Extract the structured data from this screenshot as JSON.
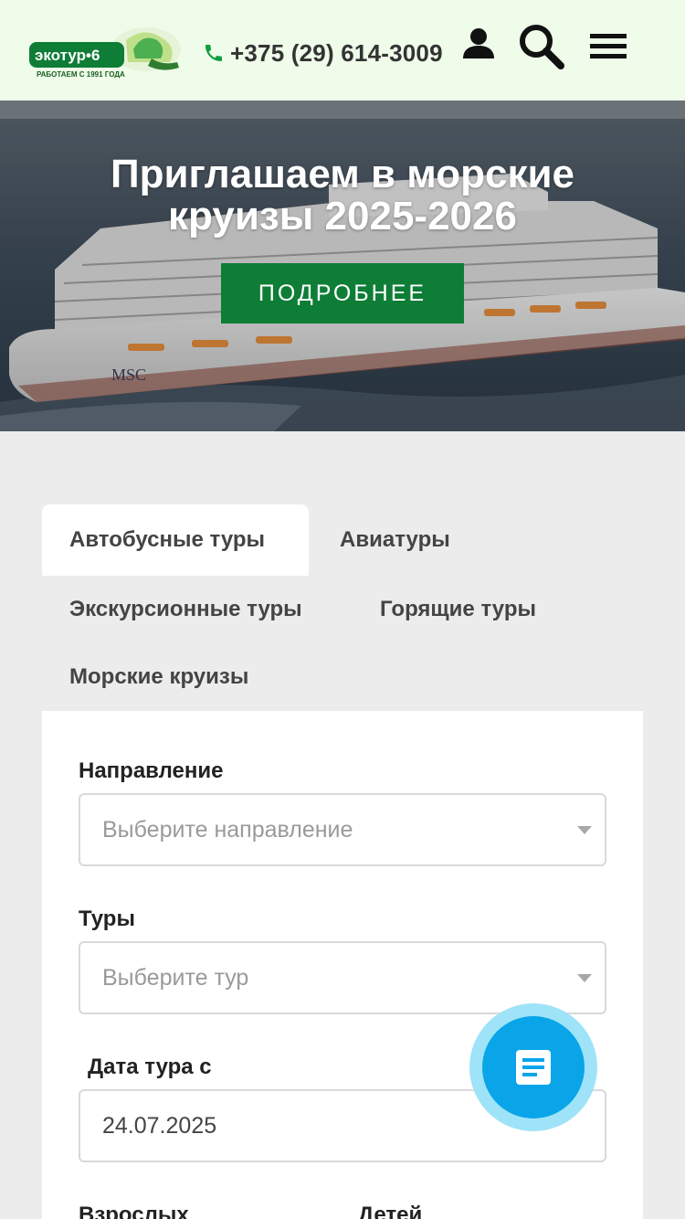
{
  "header": {
    "logo": {
      "name": "экотур•6",
      "tagline": "РАБОТАЕМ С 1991 ГОДА"
    },
    "phone": "+375 (29) 614-3009",
    "icons": [
      "phone-icon",
      "user-icon",
      "search-icon",
      "menu-icon"
    ]
  },
  "hero": {
    "title_line1": "Приглашаем в морские",
    "title_line2": "круизы 2025-2026",
    "button_label": "ПОДРОБНЕЕ",
    "ship_label": "MSC"
  },
  "tabs": [
    {
      "label": "Автобусные туры",
      "active": true
    },
    {
      "label": "Авиатуры",
      "active": false
    },
    {
      "label": "Экскурсионные туры",
      "active": false
    },
    {
      "label": "Горящие туры",
      "active": false
    },
    {
      "label": "Морские круизы",
      "active": false
    }
  ],
  "form": {
    "direction": {
      "label": "Направление",
      "placeholder": "Выберите направление"
    },
    "tours": {
      "label": "Туры",
      "placeholder": "Выберите тур"
    },
    "date_from": {
      "label": "Дата тура с",
      "value": "24.07.2025"
    },
    "adults": {
      "label": "Взрослых"
    },
    "children": {
      "label": "Детей"
    }
  },
  "colors": {
    "brand_green": "#0e7d36",
    "header_bg": "#eefce9",
    "chat_blue": "#0aa5e9"
  }
}
